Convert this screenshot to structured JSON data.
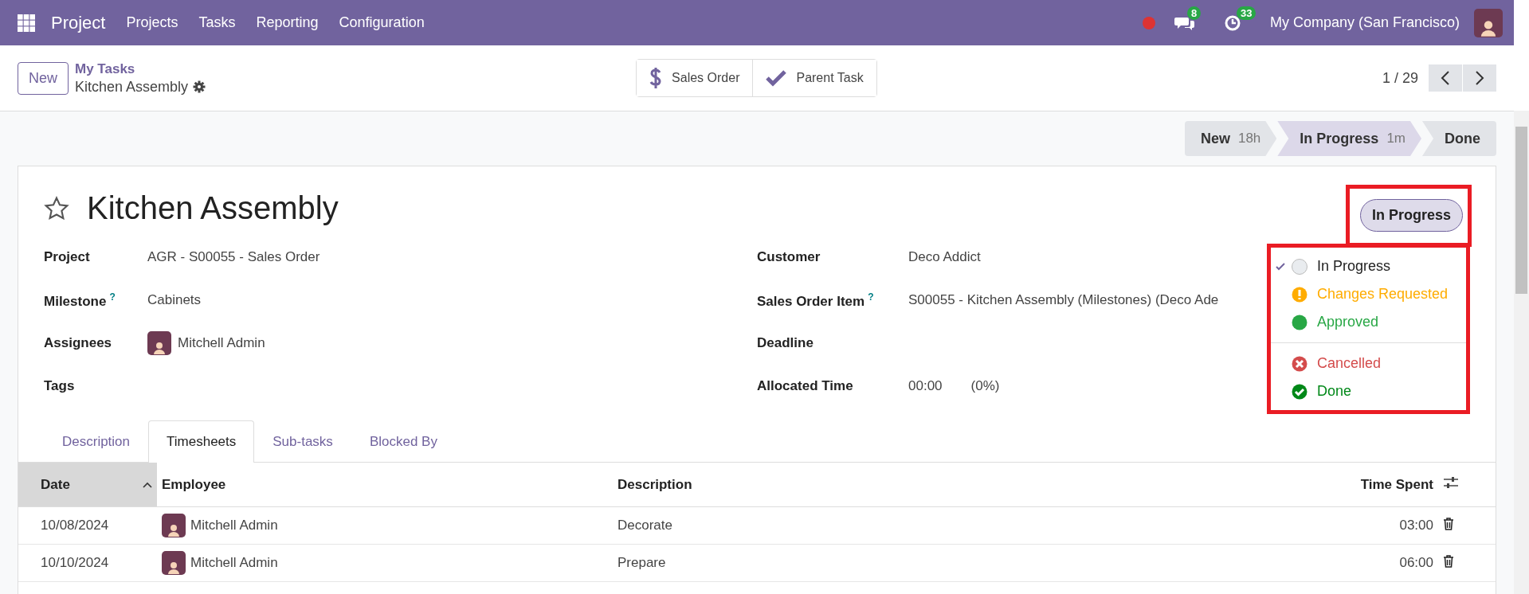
{
  "navbar": {
    "app_name": "Project",
    "menu": [
      "Projects",
      "Tasks",
      "Reporting",
      "Configuration"
    ],
    "messages_count": "8",
    "activities_count": "33",
    "company": "My Company (San Francisco)"
  },
  "control_panel": {
    "new_button": "New",
    "breadcrumb": "My Tasks",
    "record_name": "Kitchen Assembly",
    "smart_buttons": [
      {
        "kind": "dollar",
        "label": "Sales Order"
      },
      {
        "kind": "check",
        "label": "Parent Task"
      }
    ],
    "pager": "1 / 29"
  },
  "stages": [
    {
      "label": "New",
      "time": "18h",
      "selected": false
    },
    {
      "label": "In Progress",
      "time": "1m",
      "selected": true
    },
    {
      "label": "Done",
      "selected": false
    }
  ],
  "form": {
    "title": "Kitchen Assembly",
    "state_button": "In Progress",
    "left_fields": [
      {
        "label": "Project",
        "value": "AGR - S00055 - Sales Order",
        "kind": "text"
      },
      {
        "label": "Milestone",
        "help": "?",
        "value": "Cabinets",
        "kind": "text"
      },
      {
        "label": "Assignees",
        "value": "Mitchell Admin",
        "kind": "user"
      },
      {
        "label": "Tags",
        "kind": "text"
      }
    ],
    "right_fields": [
      {
        "label": "Customer",
        "value": "Deco Addict",
        "kind": "text"
      },
      {
        "label": "Sales Order Item",
        "help": "?",
        "value": "S00055 - Kitchen Assembly (Milestones) (Deco Ade",
        "kind": "text"
      },
      {
        "label": "Deadline",
        "kind": "text"
      },
      {
        "label": "Allocated Time",
        "value": "00:00",
        "extra": "(0%)",
        "kind": "time"
      }
    ],
    "state_menu": [
      {
        "kind": "normal",
        "label": "In Progress",
        "color": "#e9ecef",
        "selected": true,
        "divider_before": false
      },
      {
        "kind": "warning",
        "label": "Changes Requested",
        "color": "#ffac00",
        "selected": false,
        "divider_before": false
      },
      {
        "kind": "dot",
        "label": "Approved",
        "color": "#28a745",
        "selected": false,
        "divider_before": false
      },
      {
        "kind": "cancel",
        "label": "Cancelled",
        "color": "#d44c4c",
        "selected": false,
        "divider_before": true
      },
      {
        "kind": "done",
        "label": "Done",
        "color": "#008818",
        "selected": false,
        "divider_before": false
      }
    ]
  },
  "tabs": [
    {
      "label": "Description",
      "selected": false
    },
    {
      "label": "Timesheets",
      "selected": true
    },
    {
      "label": "Sub-tasks",
      "selected": false
    },
    {
      "label": "Blocked By",
      "selected": false
    }
  ],
  "table": {
    "columns": [
      {
        "label": "Date",
        "sorted": true
      },
      {
        "label": "Employee",
        "sorted": false
      },
      {
        "label": "Description",
        "sorted": false
      },
      {
        "label": "Time Spent",
        "sorted": false
      }
    ],
    "rows": [
      {
        "date": "10/08/2024",
        "employee": "Mitchell Admin",
        "description": "Decorate",
        "time": "03:00"
      },
      {
        "date": "10/10/2024",
        "employee": "Mitchell Admin",
        "description": "Prepare",
        "time": "06:00"
      }
    ]
  }
}
